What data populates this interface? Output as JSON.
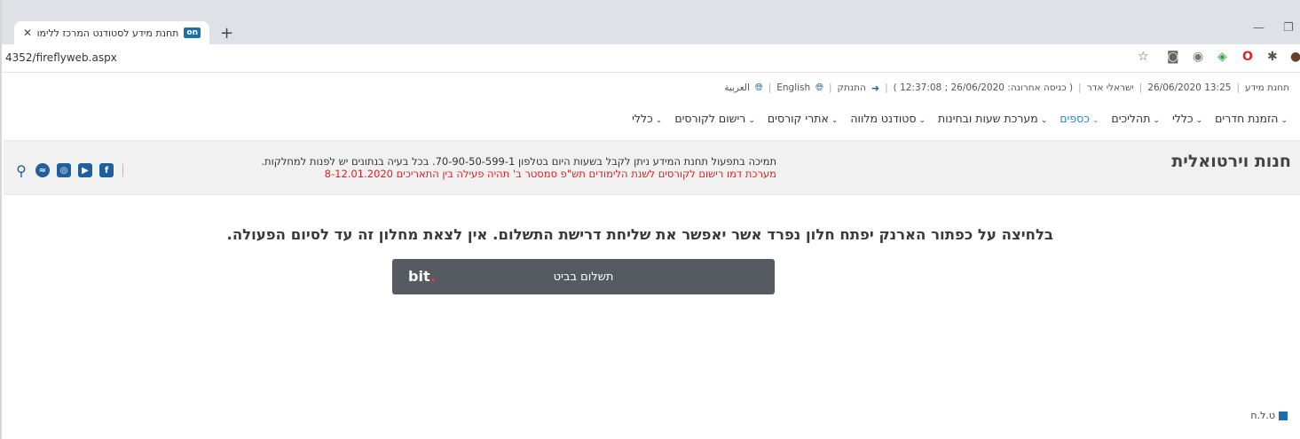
{
  "browser": {
    "tab_title": "תחנת מידע לסטודנט המרכז ללימו",
    "favicon_text": "on",
    "url": "4352/fireflyweb.aspx"
  },
  "infoline": {
    "station": "תחנת מידע",
    "datetime": "13:25 26/06/2020",
    "user": "ישראלי אדר",
    "last_login": "( כניסה אחרונה: 26/06/2020 ; 12:37:08 )",
    "logout": "התנתק",
    "english": "English",
    "arabic": "العربية"
  },
  "nav": {
    "items": [
      {
        "label": "הזמנת חדרים"
      },
      {
        "label": "כללי"
      },
      {
        "label": "תהליכים"
      },
      {
        "label": "כספים"
      },
      {
        "label": "מערכת שעות ובחינות"
      },
      {
        "label": "סטודנט מלווה"
      },
      {
        "label": "אתרי קורסים"
      },
      {
        "label": "רישום לקורסים"
      },
      {
        "label": "כללי"
      }
    ],
    "active_color": "#1e8ad6"
  },
  "banner": {
    "title": "חנות וירטואלית",
    "notice_line1": "תמיכה בתפעול תחנת המידע ניתן לקבל בשעות היום בטלפון 70-90-50-599-1. בכל בעיה בנתונים יש לפנות למחלקות.",
    "notice_line2": "מערכת דמו רישום לקורסים לשנת הלימודים תש\"פ סמסטר ב' תהיה פעילה בין התאריכים 8-12.01.2020",
    "notice_line2_color": "#e01e1e",
    "social_icons": [
      "location-icon",
      "messenger-icon",
      "instagram-icon",
      "youtube-icon",
      "facebook-icon"
    ]
  },
  "main": {
    "message": "בלחיצה על כפתור הארנק יפתח חלון נפרד אשר יאפשר את שליחת דרישת התשלום. אין לצאת מחלון זה עד לסיום הפעולה.",
    "pay_button_label": "תשלום בביט",
    "pay_logo": "bit"
  },
  "footer": {
    "text": "ט.ל.ח"
  }
}
